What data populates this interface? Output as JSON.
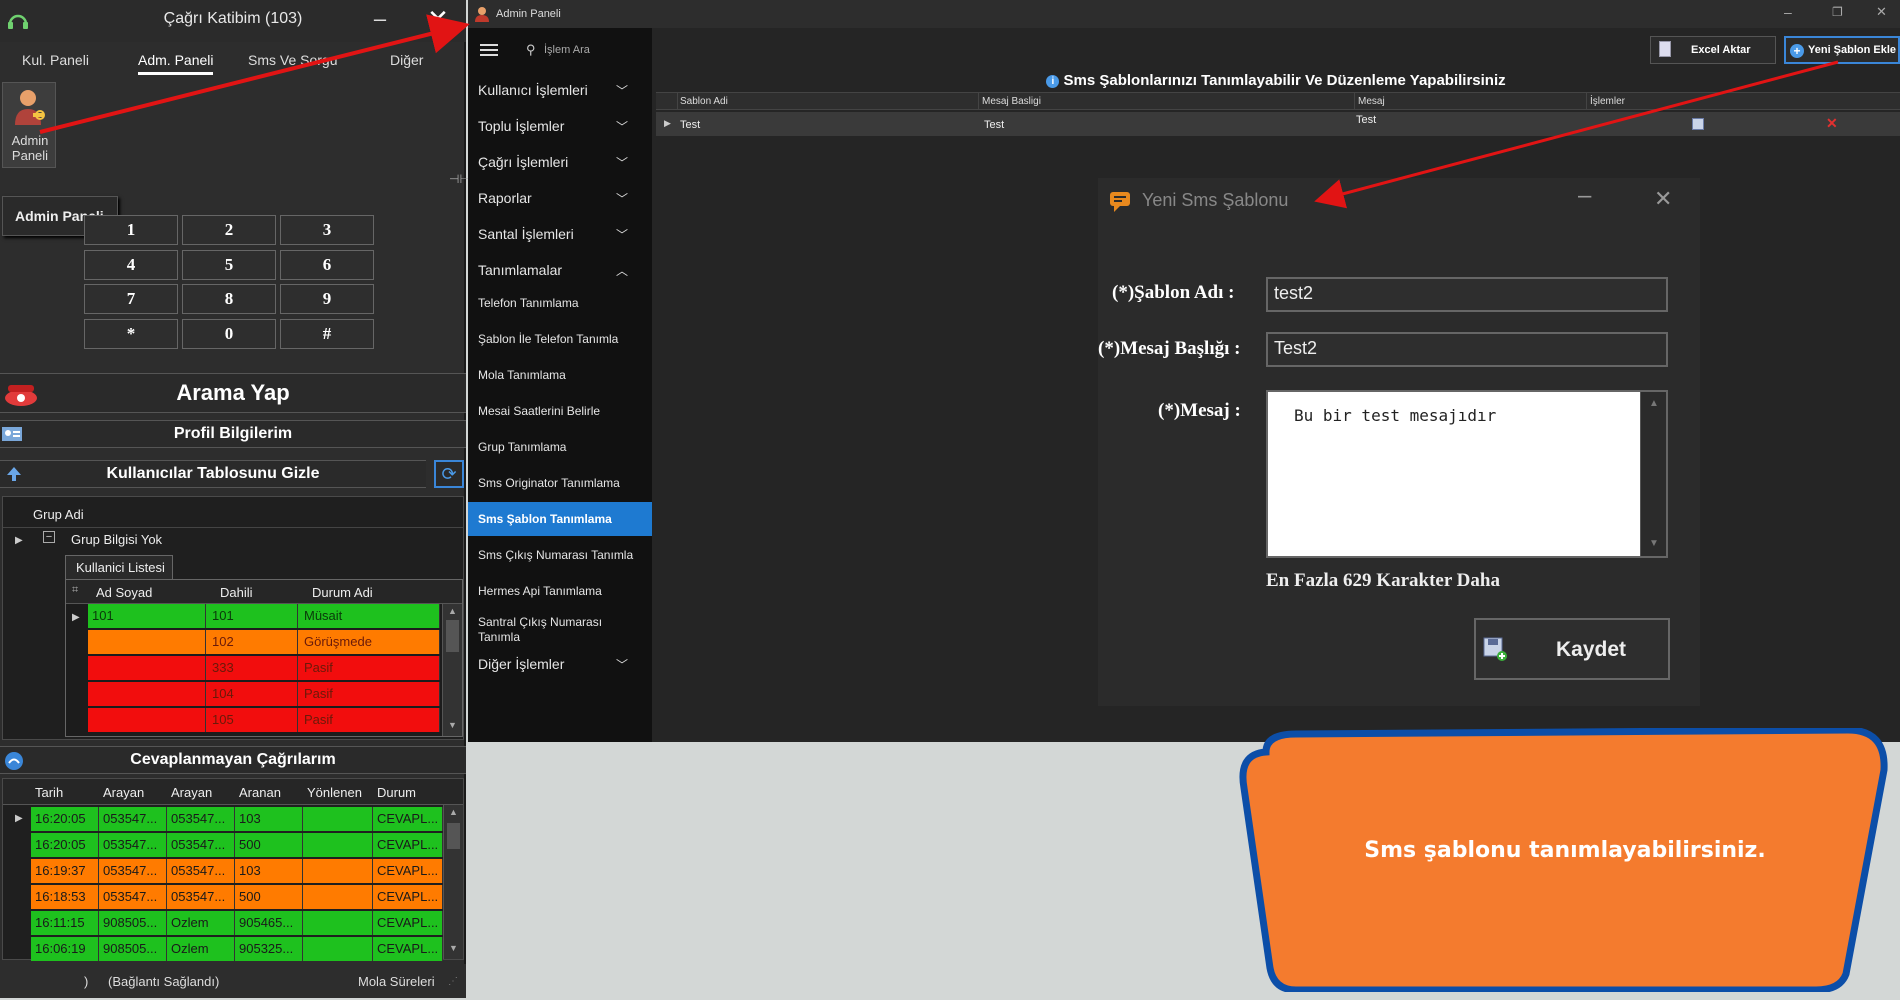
{
  "left_window": {
    "title": "Çağrı Katibim (103)",
    "tabs": [
      "Kul. Paneli",
      "Adm. Paneli",
      "Sms Ve Sorgu",
      "Diğer"
    ],
    "active_tab": "Adm. Paneli",
    "admin_tile": {
      "line1": "Admin",
      "line2": "Paneli"
    },
    "tooltip": "Admin Paneli",
    "keypad": [
      "1",
      "2",
      "3",
      "4",
      "5",
      "6",
      "7",
      "8",
      "9",
      "*",
      "0",
      "#"
    ],
    "call_button": "Arama Yap",
    "profile_button": "Profil Bilgilerim",
    "users_toggle": "Kullanıcılar Tablosunu Gizle",
    "group_header": "Grup Adi",
    "group_row": "Grup Bilgisi Yok",
    "user_list_tab": "Kullanici Listesi",
    "user_columns": [
      "Ad Soyad",
      "Dahili",
      "Durum Adi"
    ],
    "users": [
      {
        "name": "101",
        "ext": "101",
        "status": "Müsait",
        "color": "#1ec11e"
      },
      {
        "name": "",
        "ext": "102",
        "status": "Görüşmede",
        "color": "#ff7b00"
      },
      {
        "name": "",
        "ext": "333",
        "status": "Pasif",
        "color": "#f20d0d"
      },
      {
        "name": "",
        "ext": "104",
        "status": "Pasif",
        "color": "#f20d0d"
      },
      {
        "name": "",
        "ext": "105",
        "status": "Pasif",
        "color": "#f20d0d"
      }
    ],
    "missed_header": "Cevaplanmayan Çağrılarım",
    "missed_columns": [
      "Tarih",
      "Arayan",
      "Arayan",
      "Aranan",
      "Yönlenen",
      "Durum"
    ],
    "missed_calls": [
      {
        "time": "16:20:05",
        "caller": "053547...",
        "caller2": "053547...",
        "callee": "103",
        "routed": "",
        "status": "CEVAPL...",
        "color": "#1ec11e"
      },
      {
        "time": "16:20:05",
        "caller": "053547...",
        "caller2": "053547...",
        "callee": "500",
        "routed": "",
        "status": "CEVAPL...",
        "color": "#1ec11e"
      },
      {
        "time": "16:19:37",
        "caller": "053547...",
        "caller2": "053547...",
        "callee": "103",
        "routed": "",
        "status": "CEVAPL...",
        "color": "#ff7b00"
      },
      {
        "time": "16:18:53",
        "caller": "053547...",
        "caller2": "053547...",
        "callee": "500",
        "routed": "",
        "status": "CEVAPL...",
        "color": "#ff7b00"
      },
      {
        "time": "16:11:15",
        "caller": "908505...",
        "caller2": "Ozlem",
        "callee": "905465...",
        "routed": "",
        "status": "CEVAPL...",
        "color": "#1ec11e"
      },
      {
        "time": "16:06:19",
        "caller": "908505...",
        "caller2": "Ozlem",
        "callee": "905325...",
        "routed": "",
        "status": "CEVAPL...",
        "color": "#1ec11e"
      }
    ],
    "status_bar": {
      "paren": ")",
      "connection": "(Bağlantı Sağlandı)",
      "break": "Mola Süreleri"
    }
  },
  "right_window": {
    "title": "Admin Paneli",
    "search_placeholder": "İşlem Ara",
    "menu": [
      {
        "label": "Kullanıcı İşlemleri",
        "expanded": false
      },
      {
        "label": "Toplu İşlemler",
        "expanded": false
      },
      {
        "label": "Çağrı İşlemleri",
        "expanded": false
      },
      {
        "label": "Raporlar",
        "expanded": false
      },
      {
        "label": "Santal İşlemleri",
        "expanded": false
      },
      {
        "label": "Tanımlamalar",
        "expanded": true
      }
    ],
    "submenu": [
      "Telefon Tanımlama",
      "Şablon İle Telefon Tanımla",
      "Mola Tanımlama",
      "Mesai Saatlerini Belirle",
      "Grup Tanımlama",
      "Sms Originator Tanımlama",
      "Sms Şablon Tanımlama",
      "Sms Çıkış Numarası Tanımla",
      "Hermes Api Tanımlama",
      "Santral Çıkış Numarası Tanımla"
    ],
    "active_submenu": "Sms Şablon Tanımlama",
    "other_menu": "Diğer İşlemler",
    "excel_button": "Excel Aktar",
    "new_template_button": "Yeni Şablon Ekle",
    "info_text": "Sms Şablonlarınızı Tanımlayabilir Ve Düzenleme Yapabilirsiniz",
    "table_columns": [
      "Sablon Adi",
      "Mesaj Basligi",
      "Mesaj",
      "İşlemler"
    ],
    "table_rows": [
      {
        "name": "Test",
        "title": "Test",
        "message": "Test"
      }
    ],
    "dialog": {
      "title": "Yeni Sms Şablonu",
      "name_label": "(*)Şablon Adı :",
      "name_value": "test2",
      "header_label": "(*)Mesaj Başlığı :",
      "header_value": "Test2",
      "message_label": "(*)Mesaj :",
      "message_value": "Bu bir test mesajıdır",
      "remaining": "En Fazla 629 Karakter Daha",
      "save_button": "Kaydet"
    }
  },
  "callout": {
    "text": "Sms şablonu tanımlayabilirsiniz.",
    "fill": "#f47b2e",
    "border": "#0c4ea8"
  },
  "colors": {
    "arrow": "#e11414",
    "accent": "#1e7ad1"
  }
}
